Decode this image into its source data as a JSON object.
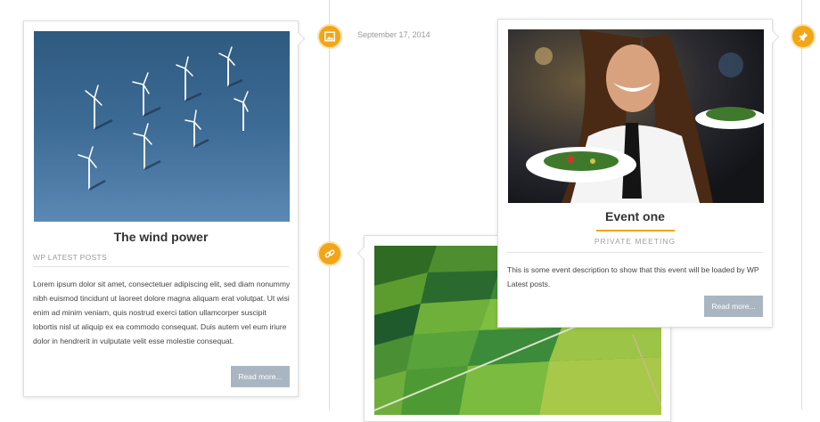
{
  "timeline": {
    "date": "September 17, 2014"
  },
  "posts": [
    {
      "title": "The wind power",
      "category": "WP LATEST POSTS",
      "body": "Lorem ipsum dolor sit amet, consectetuer adipiscing elit, sed diam nonummy nibh euismod tincidunt ut laoreet dolore magna aliquam erat volutpat. Ut wisi enim ad minim veniam, quis nostrud exerci tation ullamcorper suscipit lobortis nisl ut aliquip ex ea commodo consequat. Duis autem vel eum iriure dolor in hendrerit in vulputate velit esse molestie consequat.",
      "read_more": "Read more..."
    },
    {
      "title": "Event one",
      "category": "PRIVATE MEETING",
      "body": "This is some event description to show that this event will be loaded by WP Latest posts.",
      "read_more": "Read more..."
    }
  ],
  "colors": {
    "accent": "#f2a516",
    "button": "#a9b6c1"
  },
  "icons": [
    "image-icon",
    "link-icon",
    "pin-icon"
  ]
}
